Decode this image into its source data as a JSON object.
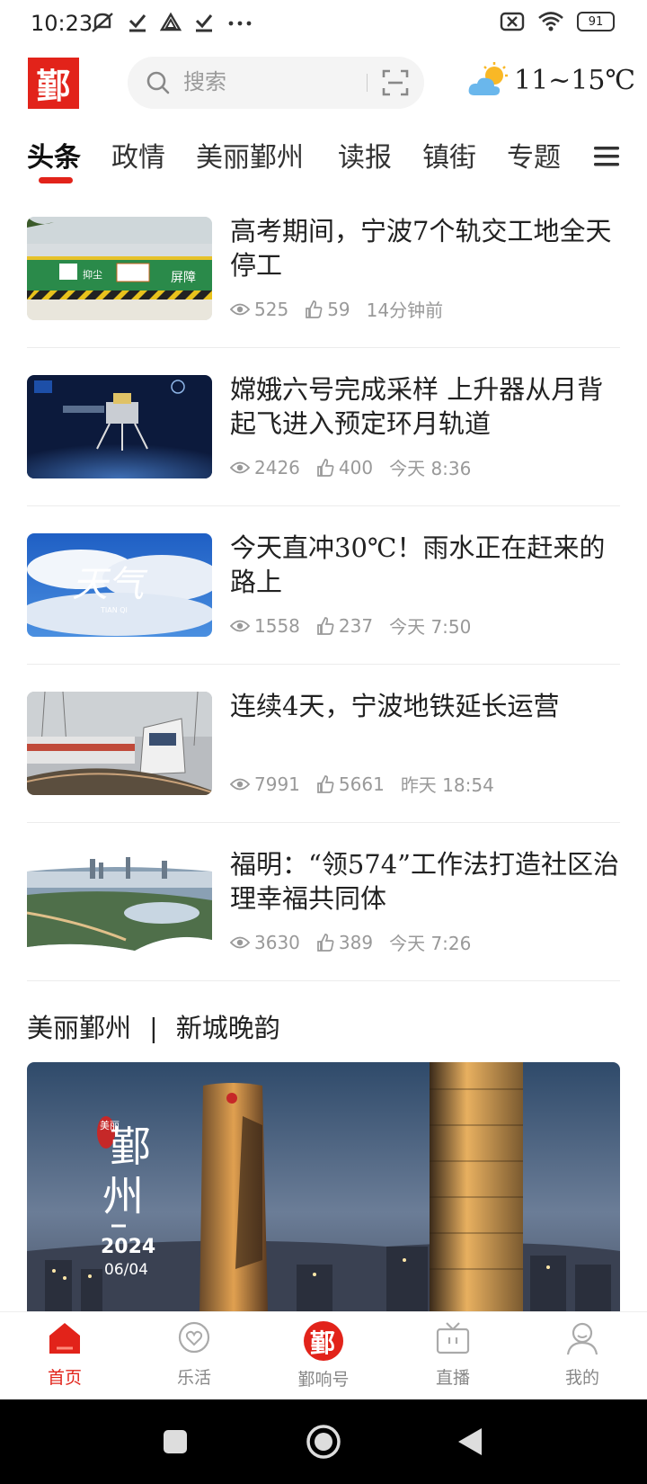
{
  "status_bar": {
    "time": "10:23",
    "battery": "91"
  },
  "header": {
    "logo_text": "鄞",
    "search_placeholder": "搜索",
    "weather": {
      "temp": "11~15℃",
      "icon": "partly-cloudy-icon"
    }
  },
  "tabs": [
    {
      "label": "头条",
      "active": true
    },
    {
      "label": "政情"
    },
    {
      "label": "美丽鄞州"
    },
    {
      "label": "读报"
    },
    {
      "label": "镇街"
    },
    {
      "label": "专题"
    }
  ],
  "news": [
    {
      "title": "高考期间，宁波7个轨交工地全天停工",
      "views": "525",
      "likes": "59",
      "time": "14分钟前",
      "thumb_text": [
        "抑尘",
        "屏障"
      ]
    },
    {
      "title": "嫦娥六号完成采样 上升器从月背起飞进入预定环月轨道",
      "views": "2426",
      "likes": "400",
      "time": "今天  8:36"
    },
    {
      "title": "今天直冲30℃！雨水正在赶来的路上",
      "views": "1558",
      "likes": "237",
      "time": "今天  7:50",
      "thumb_text": [
        "天气",
        "TIAN QI"
      ]
    },
    {
      "title": "连续4天，宁波地铁延长运营",
      "views": "7991",
      "likes": "5661",
      "time": "昨天  18:54"
    },
    {
      "title": "福明：“领574”工作法打造社区治理幸福共同体",
      "views": "3630",
      "likes": "389",
      "time": "今天  7:26"
    }
  ],
  "section": {
    "left": "美丽鄞州",
    "sep": "|",
    "right": "新城晚韵"
  },
  "feature": {
    "badge": "美丽",
    "title_1": "鄞",
    "title_2": "州",
    "year": "2024",
    "date": "06/04"
  },
  "bottom_nav": [
    {
      "label": "首页",
      "icon": "home-icon",
      "active": true
    },
    {
      "label": "乐活",
      "icon": "heart-chat-icon"
    },
    {
      "label": "鄞响号",
      "icon": "logo-icon"
    },
    {
      "label": "直播",
      "icon": "tv-icon"
    },
    {
      "label": "我的",
      "icon": "profile-icon"
    }
  ],
  "colors": {
    "accent": "#e2231a"
  }
}
